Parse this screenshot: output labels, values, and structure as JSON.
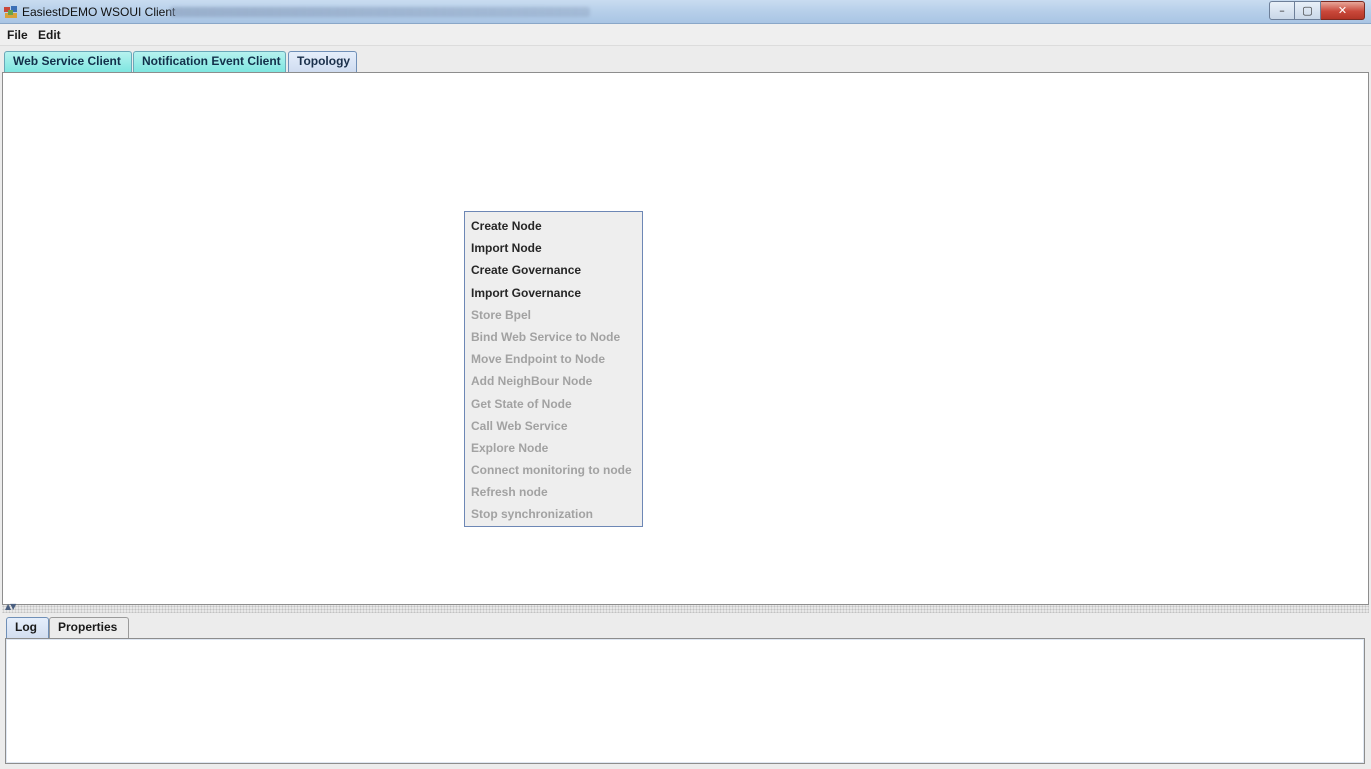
{
  "window": {
    "title": "EasiestDEMO WSOUI Client",
    "controls": {
      "minimize": "–",
      "maximize": "▢",
      "close": "✕"
    }
  },
  "menubar": {
    "items": [
      "File",
      "Edit"
    ]
  },
  "top_tabs": [
    "Web Service Client",
    "Notification Event Client",
    "Topology"
  ],
  "active_top_tab": "Topology",
  "context_menu": {
    "items": [
      {
        "label": "Create Node",
        "enabled": true
      },
      {
        "label": "Import Node",
        "enabled": true
      },
      {
        "label": "Create Governance",
        "enabled": true
      },
      {
        "label": "Import Governance",
        "enabled": true
      },
      {
        "label": "Store Bpel",
        "enabled": false
      },
      {
        "label": "Bind Web Service to Node",
        "enabled": false
      },
      {
        "label": "Move Endpoint to Node",
        "enabled": false
      },
      {
        "label": "Add NeighBour Node",
        "enabled": false
      },
      {
        "label": "Get State of Node",
        "enabled": false
      },
      {
        "label": "Call Web Service",
        "enabled": false
      },
      {
        "label": "Explore Node",
        "enabled": false
      },
      {
        "label": "Connect monitoring to node",
        "enabled": false
      },
      {
        "label": "Refresh node",
        "enabled": false
      },
      {
        "label": "Stop synchronization",
        "enabled": false
      }
    ]
  },
  "bottom_tabs": [
    "Log",
    "Properties"
  ],
  "active_bottom_tab": "Log",
  "colors": {
    "tab_cyan": "#7ee6e0",
    "tab_active": "#cfdcf0",
    "menu_enabled_text": "#262626",
    "menu_disabled_text": "#a2a2a2",
    "menu_border": "#6d87b5"
  }
}
